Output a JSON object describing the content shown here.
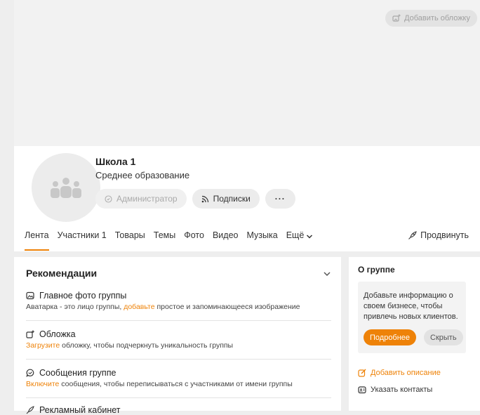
{
  "cover": {
    "add_cover_label": "Добавить обложку"
  },
  "group": {
    "name": "Школа 1",
    "category": "Среднее образование",
    "admin_label": "Администратор",
    "subscriptions_label": "Подписки",
    "more_label": "···"
  },
  "tabs": [
    {
      "label": "Лента"
    },
    {
      "label": "Участники 1"
    },
    {
      "label": "Товары"
    },
    {
      "label": "Темы"
    },
    {
      "label": "Фото"
    },
    {
      "label": "Видео"
    },
    {
      "label": "Музыка"
    },
    {
      "label": "Ещё"
    }
  ],
  "promote_label": "Продвинуть",
  "recommendations": {
    "title": "Рекомендации",
    "items": [
      {
        "title": "Главное фото группы",
        "desc_pre": "Аватарка - это лицо группы, ",
        "desc_link": "добавьте",
        "desc_post": " простое и запоминающееся изображение"
      },
      {
        "title": "Обложка",
        "desc_pre": "",
        "desc_link": "Загрузите",
        "desc_post": " обложку, чтобы подчеркнуть уникальность группы"
      },
      {
        "title": "Сообщения группе",
        "desc_pre": "",
        "desc_link": "Включите",
        "desc_post": " сообщения, чтобы переписываться с участниками от имени группы"
      },
      {
        "title": "Рекламный кабинет"
      }
    ]
  },
  "about": {
    "title": "О группе",
    "text": "Добавьте информацию о своем бизнесе, чтобы привлечь новых клиентов.",
    "more_button": "Подробнее",
    "hide_button": "Скрыть",
    "add_description": "Добавить описание",
    "contacts": "Указать контакты"
  },
  "colors": {
    "accent": "#ee8208"
  }
}
